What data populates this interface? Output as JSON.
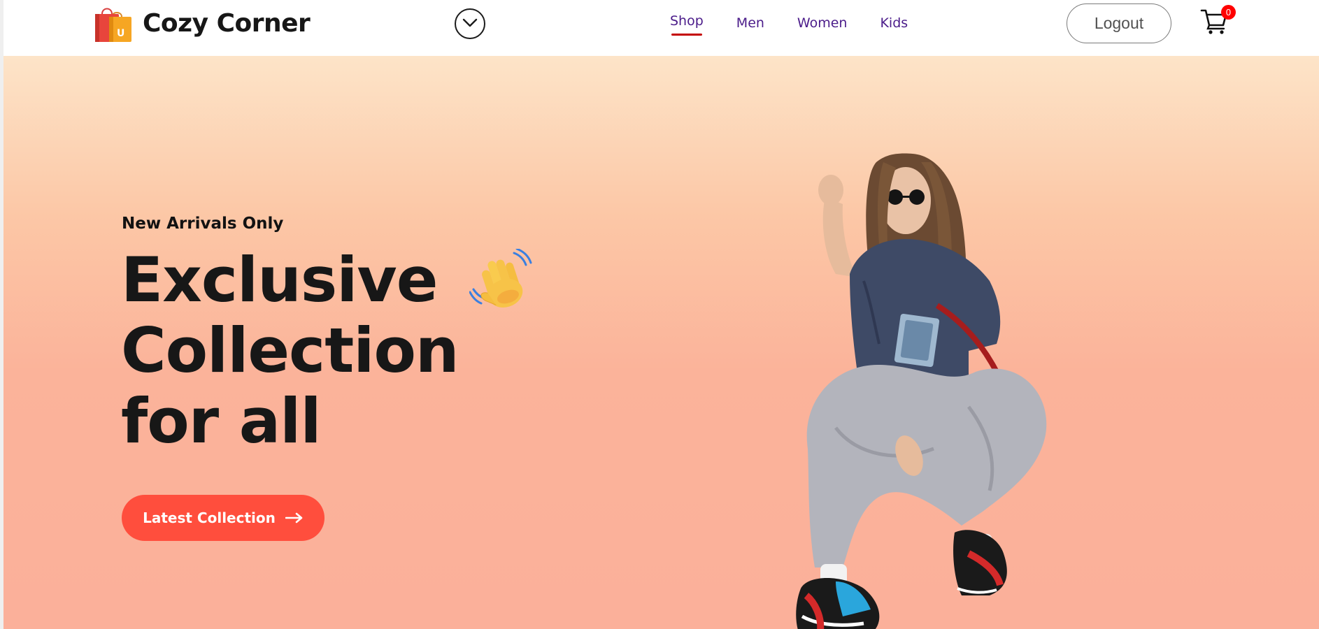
{
  "brand": {
    "name": "Cozy Corner",
    "logo_icon": "shopping-bags-icon",
    "logo_letter": "U"
  },
  "nav": {
    "dropdown_icon": "chevron-down-icon",
    "items": [
      {
        "label": "Shop",
        "active": true
      },
      {
        "label": "Men",
        "active": false
      },
      {
        "label": "Women",
        "active": false
      },
      {
        "label": "Kids",
        "active": false
      }
    ],
    "logout_label": "Logout",
    "cart_icon": "cart-icon",
    "cart_count": "0"
  },
  "hero": {
    "eyebrow": "New Arrivals Only",
    "title_lines": [
      "Exclusive",
      "Collection",
      "for all"
    ],
    "title_icon": "waving-hand-icon",
    "cta_label": "Latest Collection",
    "cta_icon": "arrow-right-icon",
    "image_subject": "hero-model-image"
  },
  "colors": {
    "nav_text": "#4b1c8a",
    "active_underline": "#c40000",
    "cta_bg": "#ff4e3d",
    "badge": "#ff0000",
    "hero_gradient_top": "#fde4c8",
    "hero_gradient_bottom": "#fbb09a"
  }
}
